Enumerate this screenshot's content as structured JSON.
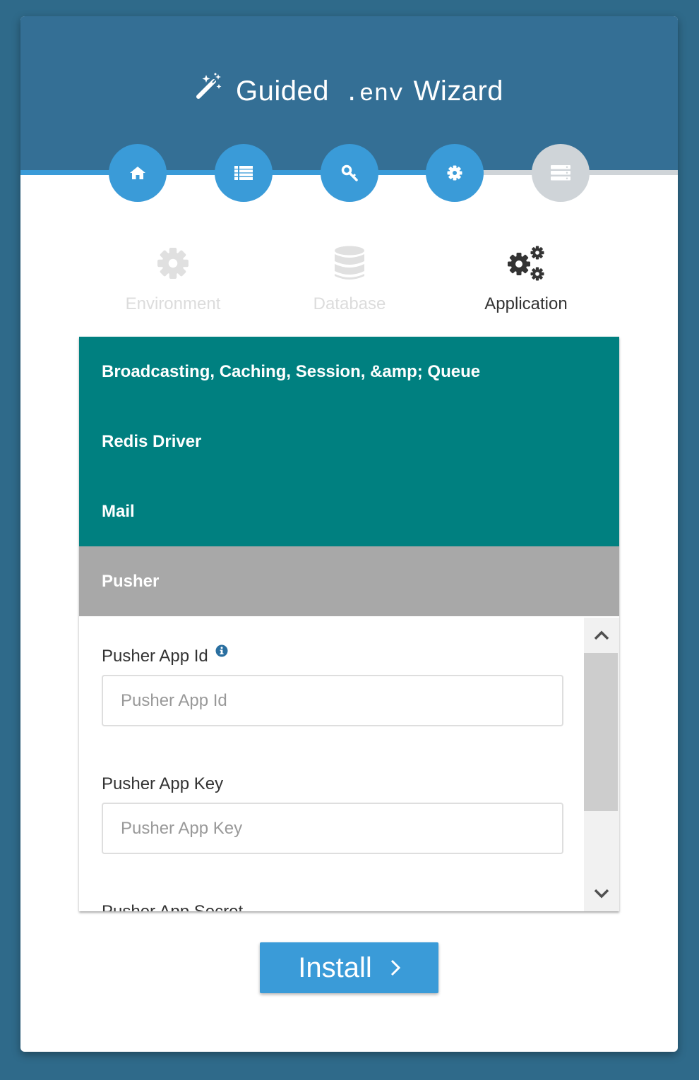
{
  "header": {
    "title_left": "Guided",
    "title_mono": ".env",
    "title_right": "Wizard"
  },
  "colors": {
    "header_bg": "#346f95",
    "accent": "#3a9bd8",
    "inactive_step": "#cfd4d8",
    "section_bg": "#008080",
    "open_section_bg": "#a8a8a8",
    "page_bg": "#2f6a8a"
  },
  "steps": [
    {
      "icon": "home-icon",
      "state": "complete"
    },
    {
      "icon": "list-icon",
      "state": "complete"
    },
    {
      "icon": "key-icon",
      "state": "complete"
    },
    {
      "icon": "gear-icon",
      "state": "current"
    },
    {
      "icon": "server-icon",
      "state": "pending"
    }
  ],
  "tabs": [
    {
      "label": "Environment",
      "icon": "gear-icon",
      "active": false
    },
    {
      "label": "Database",
      "icon": "database-icon",
      "active": false
    },
    {
      "label": "Application",
      "icon": "gears-icon",
      "active": true
    }
  ],
  "sections": [
    {
      "title": "Broadcasting, Caching, Session, &amp; Queue"
    },
    {
      "title": "Redis Driver"
    },
    {
      "title": "Mail"
    },
    {
      "title": "Pusher"
    }
  ],
  "pusher": {
    "app_id_label": "Pusher App Id",
    "app_id_placeholder": "Pusher App Id",
    "app_key_label": "Pusher App Key",
    "app_key_placeholder": "Pusher App Key",
    "app_secret_label": "Pusher App Secret"
  },
  "install_label": "Install"
}
